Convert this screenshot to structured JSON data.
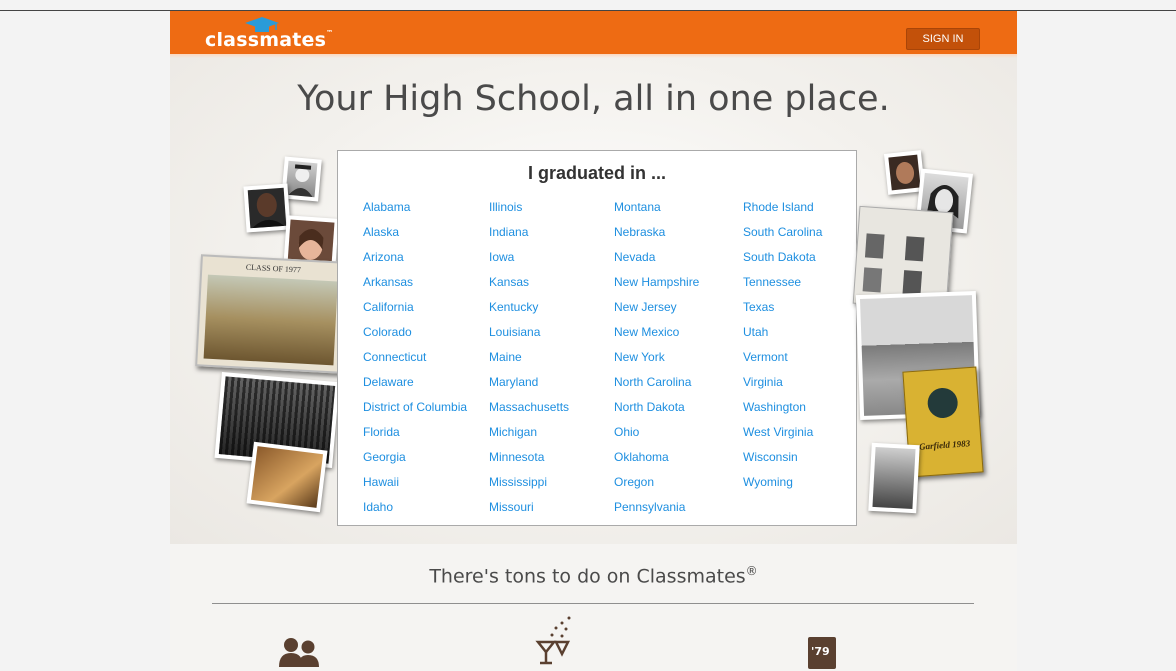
{
  "header": {
    "logo_text": "classmates",
    "logo_tm": "™",
    "sign_in_label": "SIGN IN",
    "brand_color": "#ee6b13"
  },
  "hero": {
    "headline": "Your High School, all in one place."
  },
  "graduated": {
    "title": "I graduated in ...",
    "link_color": "#1e8fe0",
    "columns": [
      [
        "Alabama",
        "Alaska",
        "Arizona",
        "Arkansas",
        "California",
        "Colorado",
        "Connecticut",
        "Delaware",
        "District of Columbia",
        "Florida",
        "Georgia",
        "Hawaii",
        "Idaho"
      ],
      [
        "Illinois",
        "Indiana",
        "Iowa",
        "Kansas",
        "Kentucky",
        "Louisiana",
        "Maine",
        "Maryland",
        "Massachusetts",
        "Michigan",
        "Minnesota",
        "Mississippi",
        "Missouri"
      ],
      [
        "Montana",
        "Nebraska",
        "Nevada",
        "New Hampshire",
        "New Jersey",
        "New Mexico",
        "New York",
        "North Carolina",
        "North Dakota",
        "Ohio",
        "Oklahoma",
        "Oregon",
        "Pennsylvania"
      ],
      [
        "Rhode Island",
        "South Carolina",
        "South Dakota",
        "Tennessee",
        "Texas",
        "Utah",
        "Vermont",
        "Virginia",
        "Washington",
        "West Virginia",
        "Wisconsin",
        "Wyoming"
      ]
    ]
  },
  "collage": {
    "yearbook_left_label": "CLASS OF 1977",
    "yearbook_right_label": "Garfield 1983"
  },
  "features": {
    "heading": "There's tons to do on Classmates",
    "heading_mark": "®",
    "icons": [
      "people-icon",
      "party-cocktail-icon",
      "yearbook-icon"
    ],
    "yearbook_icon_text": "'79"
  }
}
